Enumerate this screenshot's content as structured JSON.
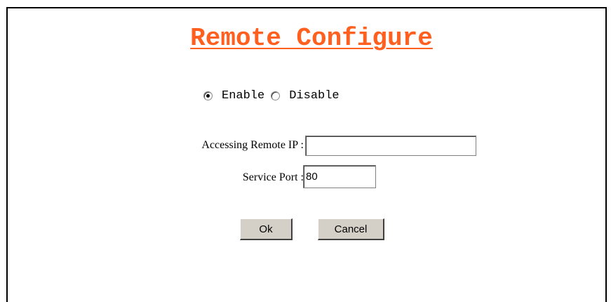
{
  "title": "Remote Configure",
  "mode": {
    "options": [
      {
        "label": "Enable",
        "selected": true
      },
      {
        "label": "Disable",
        "selected": false
      }
    ]
  },
  "fields": {
    "remote_ip": {
      "label": "Accessing Remote IP :",
      "value": ""
    },
    "service_port": {
      "label": "Service Port :",
      "value": "80"
    }
  },
  "buttons": {
    "ok": "Ok",
    "cancel": "Cancel"
  },
  "colors": {
    "title": "#ff6020",
    "button_face": "#d4d0c8"
  }
}
